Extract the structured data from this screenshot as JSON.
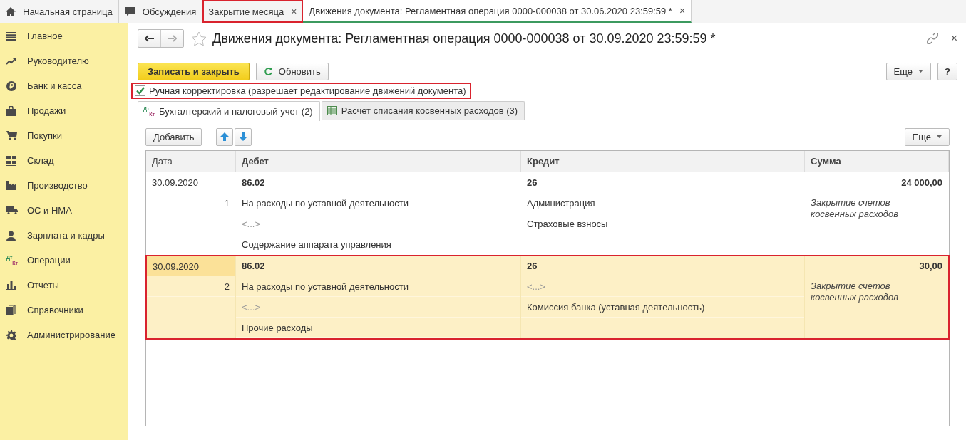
{
  "top_tabs": [
    {
      "label": "Начальная страница",
      "selected": false,
      "annotated": false
    },
    {
      "label": "Обсуждения",
      "selected": false,
      "annotated": false
    },
    {
      "label": "Закрытие месяца",
      "selected": false,
      "annotated": true,
      "close": "×"
    },
    {
      "label": "Движения документа: Регламентная операция 0000-000038 от 30.06.2020 23:59:59 *",
      "selected": true,
      "annotated": false,
      "close": "×"
    }
  ],
  "sidebar": {
    "items": [
      {
        "label": "Главное"
      },
      {
        "label": "Руководителю"
      },
      {
        "label": "Банк и касса"
      },
      {
        "label": "Продажи"
      },
      {
        "label": "Покупки"
      },
      {
        "label": "Склад"
      },
      {
        "label": "Производство"
      },
      {
        "label": "ОС и НМА"
      },
      {
        "label": "Зарплата и кадры"
      },
      {
        "label": "Операции",
        "icon_text": [
          "Дт",
          "Кт"
        ]
      },
      {
        "label": "Отчеты"
      },
      {
        "label": "Справочники"
      },
      {
        "label": "Администрирование"
      }
    ]
  },
  "form": {
    "title": "Движения документа: Регламентная операция 0000-000038 от 30.09.2020 23:59:59 *",
    "close": "×",
    "buttons": [
      {
        "label": "Записать и закрыть",
        "kind": "primary"
      },
      {
        "label": "Обновить",
        "kind": "refresh"
      }
    ],
    "more": "Еще",
    "help": "?",
    "manual_edit": {
      "label": "Ручная корректировка (разрешает редактирование движений документа)",
      "checked": true,
      "annotated": true
    },
    "tabs": [
      {
        "label": "Бухгалтерский и налоговый учет (2)",
        "selected": true,
        "icon_text": [
          "Дт",
          "Кт"
        ]
      },
      {
        "label": "Расчет списания косвенных расходов (3)",
        "selected": false
      }
    ],
    "table_toolbar": {
      "add": "Добавить",
      "more": "Еще"
    },
    "table": {
      "columns": [
        "Дата",
        "Дебет",
        "Кредит",
        "Сумма"
      ],
      "rows": [
        {
          "date": "30.09.2020",
          "number": "1",
          "selected": false,
          "annotated": false,
          "debit": {
            "account": "86.02",
            "subconto": [
              {
                "text": "На расходы по уставной деятельности",
                "empty": false
              },
              {
                "text": "<...>",
                "empty": true
              },
              {
                "text": "Содержание аппарата управления",
                "empty": false
              }
            ]
          },
          "credit": {
            "account": "26",
            "subconto": [
              {
                "text": "Администрация",
                "empty": false
              },
              {
                "text": "Страховые взносы",
                "empty": false
              }
            ]
          },
          "sum": "24 000,00",
          "content": "Закрытие счетов косвенных расходов"
        },
        {
          "date": "30.09.2020",
          "number": "2",
          "selected": true,
          "annotated": true,
          "debit": {
            "account": "86.02",
            "subconto": [
              {
                "text": "На расходы по уставной деятельности",
                "empty": false
              },
              {
                "text": "<...>",
                "empty": true
              },
              {
                "text": "Прочие расходы",
                "empty": false
              }
            ]
          },
          "credit": {
            "account": "26",
            "subconto": [
              {
                "text": "<...>",
                "empty": true
              },
              {
                "text": "Комиссия банка (уставная деятельность)",
                "empty": false
              }
            ]
          },
          "sum": "30,00",
          "content": "Закрытие счетов косвенных расходов"
        }
      ]
    }
  }
}
